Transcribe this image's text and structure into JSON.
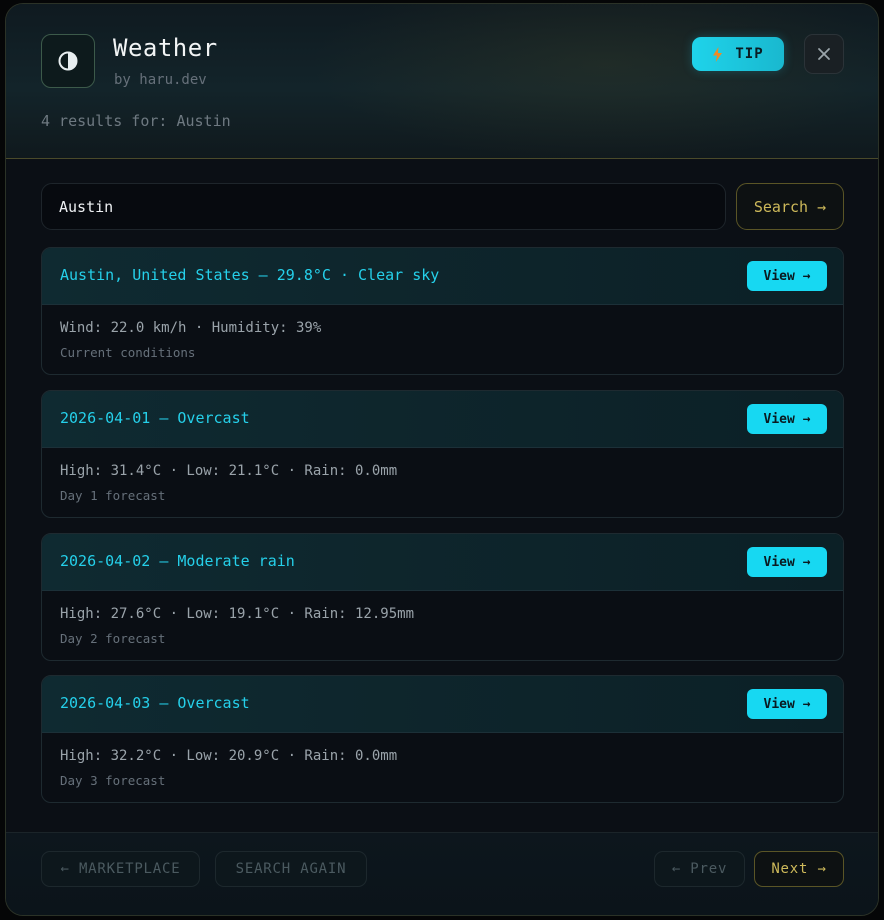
{
  "header": {
    "title": "Weather",
    "author": "by haru.dev",
    "results_text": "4 results for: Austin",
    "tip_label": "TIP",
    "tip_icon": "lightning-icon",
    "close_icon": "close-icon",
    "app_icon": "contrast-icon"
  },
  "search": {
    "value": "Austin",
    "button_label": "Search →"
  },
  "cards": [
    {
      "title": "Austin, United States — 29.8°C · Clear sky",
      "line1": "Wind: 22.0 km/h · Humidity: 39%",
      "line2": "Current conditions",
      "view_label": "View →"
    },
    {
      "title": "2026-04-01 — Overcast",
      "line1": "High: 31.4°C · Low: 21.1°C · Rain: 0.0mm",
      "line2": "Day 1 forecast",
      "view_label": "View →"
    },
    {
      "title": "2026-04-02 — Moderate rain",
      "line1": "High: 27.6°C · Low: 19.1°C · Rain: 12.95mm",
      "line2": "Day 2 forecast",
      "view_label": "View →"
    },
    {
      "title": "2026-04-03 — Overcast",
      "line1": "High: 32.2°C · Low: 20.9°C · Rain: 0.0mm",
      "line2": "Day 3 forecast",
      "view_label": "View →"
    }
  ],
  "footer": {
    "marketplace_label": "← MARKETPLACE",
    "search_again_label": "SEARCH AGAIN",
    "prev_label": "← Prev",
    "next_label": "Next →"
  },
  "colors": {
    "accent": "#17d8f2",
    "gold": "#cdb95a",
    "background": "#0b0f15"
  }
}
